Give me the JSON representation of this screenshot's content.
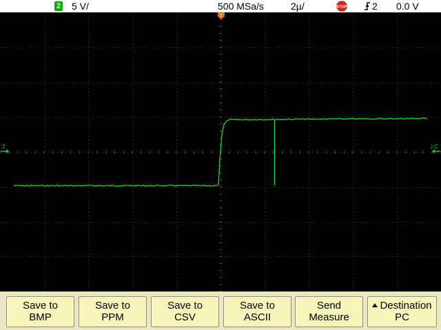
{
  "status": {
    "channel_number": "2",
    "volts_per_div": "5 V/",
    "sample_rate": "500 MSa/s",
    "time_per_div": "2µ/",
    "run_state": "STOP",
    "trigger_channel": "2",
    "trigger_level": "0.0 V"
  },
  "markers": {
    "channel_ground": "2",
    "trigger_level_marker": "C",
    "trigger_level_channel": "2"
  },
  "colors": {
    "trace": "#22cc22",
    "channel_badge": "#00aa00",
    "grid": "#3c3c3c",
    "softkey_face": "#f7f5ba",
    "stop": "#d62020"
  },
  "softkeys": [
    {
      "line1": "Save to",
      "line2": "BMP"
    },
    {
      "line1": "Save to",
      "line2": "PPM"
    },
    {
      "line1": "Save to",
      "line2": "CSV"
    },
    {
      "line1": "Save to",
      "line2": "ASCII"
    },
    {
      "line1": "Send",
      "line2": "Measure"
    },
    {
      "line1": "Destination",
      "line2": "PC"
    }
  ]
}
